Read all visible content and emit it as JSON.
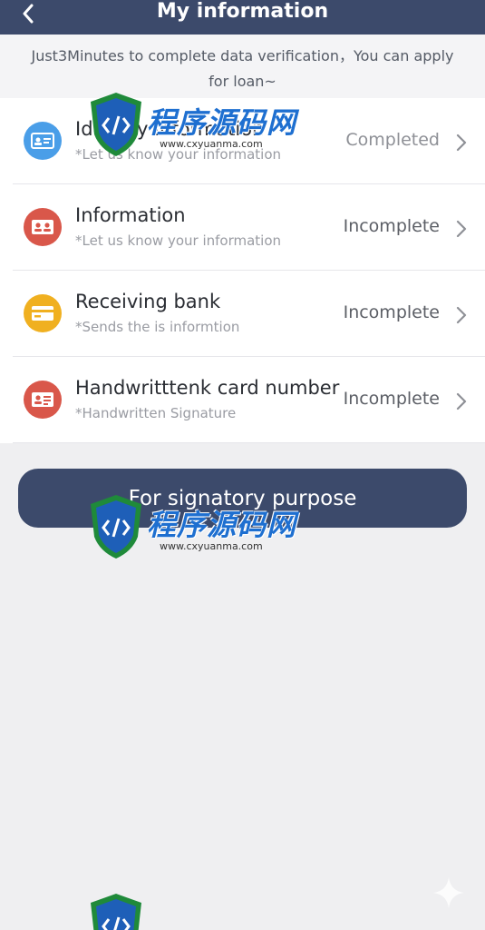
{
  "header": {
    "title": "My information",
    "back_icon": "chevron-left-icon"
  },
  "notice": {
    "text": "Just3Minutes to complete data verification，You can apply for loan~"
  },
  "rows": [
    {
      "title": "Identity information",
      "subtitle": "*Let us know your information",
      "status": "Completed",
      "icon": "id-card-icon",
      "icon_color": "#4a9ee8"
    },
    {
      "title": "Information",
      "subtitle": "*Let us know your information",
      "status": "Incomplete",
      "icon": "person-card-icon",
      "icon_color": "#d9574a"
    },
    {
      "title": "Receiving bank",
      "subtitle": "*Sends the is informtion",
      "status": "Incomplete",
      "icon": "bank-card-icon",
      "icon_color": "#f0b020"
    },
    {
      "title": "Handwritttenk card number",
      "subtitle": "*Handwritten Signature",
      "status": "Incomplete",
      "icon": "signature-card-icon",
      "icon_color": "#d9574a"
    }
  ],
  "submit": {
    "label": "For signatory purpose"
  },
  "watermark": {
    "cn": "程序源码网",
    "url": "www.cxyuanma.com"
  },
  "colors": {
    "header_bg": "#3c4a6b",
    "page_bg": "#efeff1",
    "button_bg": "#3c4a6b"
  }
}
